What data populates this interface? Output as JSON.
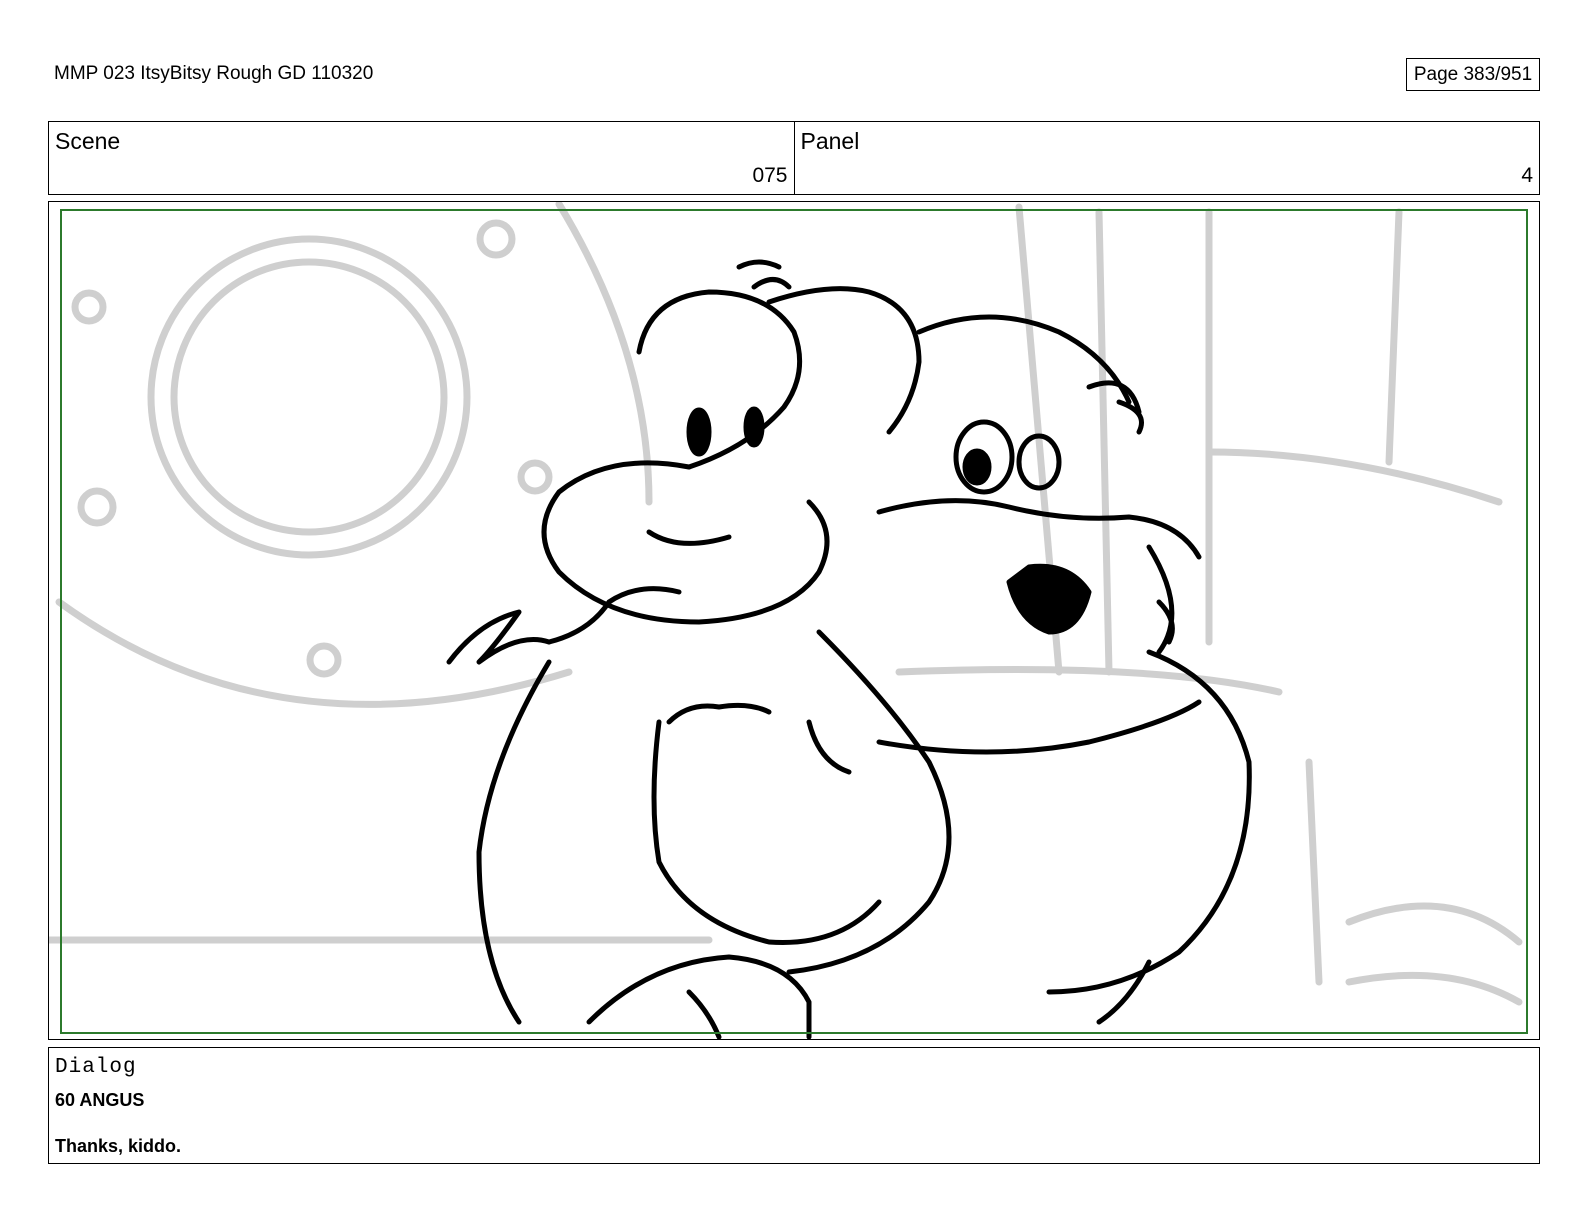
{
  "header": {
    "doc_title": "MMP 023 ItsyBitsy Rough GD 110320",
    "page": "Page 383/951"
  },
  "scene": {
    "label": "Scene",
    "value": "075"
  },
  "panel": {
    "label": "Panel",
    "value": "4"
  },
  "dialog": {
    "label": "Dialog",
    "lines": [
      "60 ANGUS",
      "Thanks, kiddo."
    ]
  },
  "colors": {
    "safe_frame": "#2c7a2c",
    "background_sketch": "#c8c8c8",
    "line_art": "#000000"
  }
}
